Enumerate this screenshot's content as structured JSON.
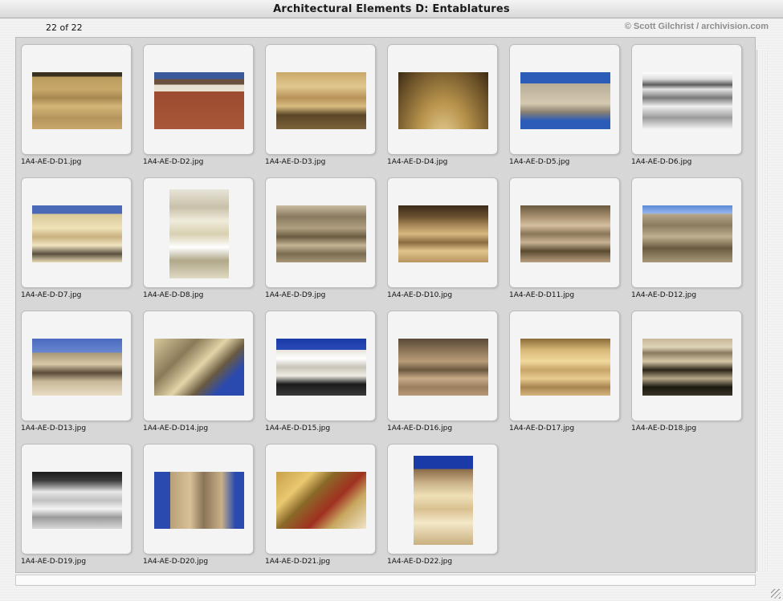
{
  "window": {
    "title": "Architectural Elements D: Entablatures",
    "count": "22 of 22",
    "copyright": "© Scott Gilchrist / archivision.com"
  },
  "thumbnails": [
    {
      "filename": "1A4-AE-D-D1.jpg"
    },
    {
      "filename": "1A4-AE-D-D2.jpg"
    },
    {
      "filename": "1A4-AE-D-D3.jpg"
    },
    {
      "filename": "1A4-AE-D-D4.jpg"
    },
    {
      "filename": "1A4-AE-D-D5.jpg"
    },
    {
      "filename": "1A4-AE-D-D6.jpg"
    },
    {
      "filename": "1A4-AE-D-D7.jpg"
    },
    {
      "filename": "1A4-AE-D-D8.jpg"
    },
    {
      "filename": "1A4-AE-D-D9.jpg"
    },
    {
      "filename": "1A4-AE-D-D10.jpg"
    },
    {
      "filename": "1A4-AE-D-D11.jpg"
    },
    {
      "filename": "1A4-AE-D-D12.jpg"
    },
    {
      "filename": "1A4-AE-D-D13.jpg"
    },
    {
      "filename": "1A4-AE-D-D14.jpg"
    },
    {
      "filename": "1A4-AE-D-D15.jpg"
    },
    {
      "filename": "1A4-AE-D-D16.jpg"
    },
    {
      "filename": "1A4-AE-D-D17.jpg"
    },
    {
      "filename": "1A4-AE-D-D18.jpg"
    },
    {
      "filename": "1A4-AE-D-D19.jpg"
    },
    {
      "filename": "1A4-AE-D-D20.jpg"
    },
    {
      "filename": "1A4-AE-D-D21.jpg"
    },
    {
      "filename": "1A4-AE-D-D22.jpg"
    }
  ]
}
